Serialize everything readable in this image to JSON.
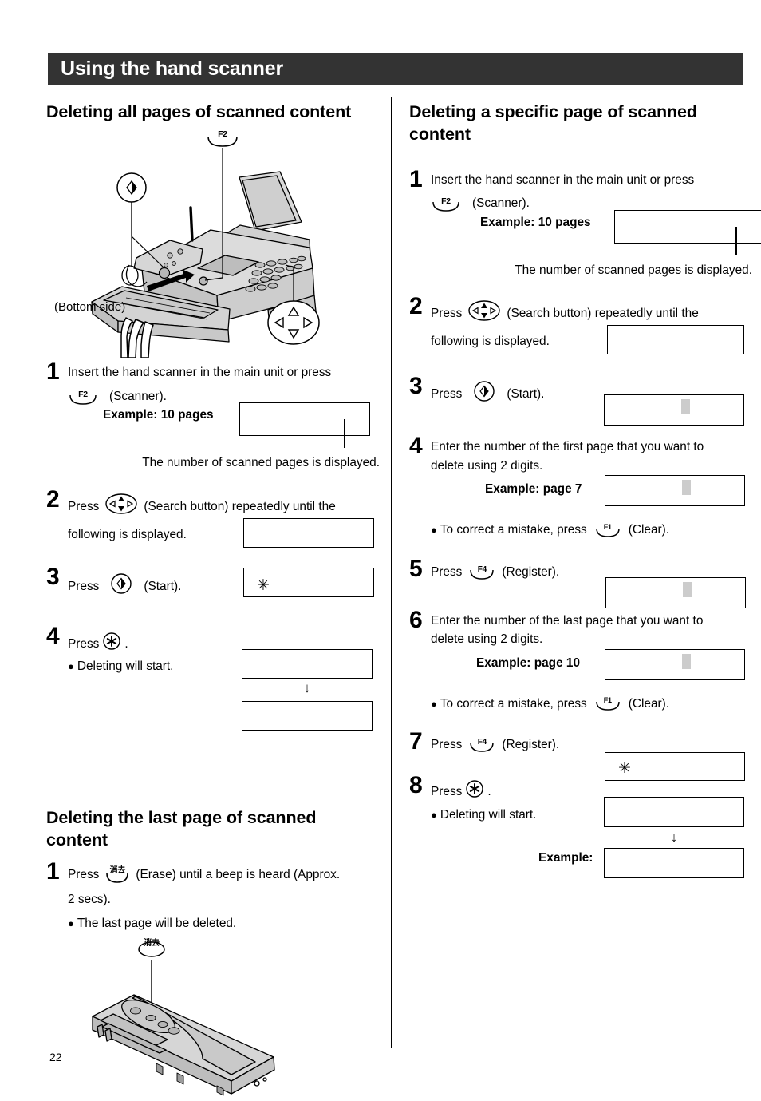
{
  "page": {
    "number": "22",
    "banner_title": "Using the hand scanner"
  },
  "left_column": {
    "section1": {
      "title": "Deleting all pages of scanned content",
      "illustration": {
        "key_label_f2": "F2",
        "caption_bottom_side": "(Bottom side)"
      },
      "steps": [
        {
          "num": "1",
          "text_line1": "Insert the hand scanner in the main unit or press",
          "key_label": "F2",
          "key_caption": "(Scanner).",
          "example_label": "Example: 10 pages",
          "note": "The number of scanned pages is displayed.",
          "lcd": {
            "content": "",
            "cursor": false,
            "tick": true
          }
        },
        {
          "num": "2",
          "text_line1": "Press",
          "key_name": "search-button",
          "text_line2": "(Search button) repeatedly until the",
          "text_line3": "following is displayed.",
          "lcd": {
            "content": "",
            "cursor": false,
            "tick": false
          }
        },
        {
          "num": "3",
          "text_line1": "Press",
          "key_name": "start-button",
          "text_line2": "(Start).",
          "lcd": {
            "content": "✳",
            "cursor": false,
            "tick": false
          }
        },
        {
          "num": "4",
          "text_line1": "Press",
          "key_name": "asterisk-button",
          "text_line2": ".",
          "bullet": "Deleting will start.",
          "lcd": {
            "content": "",
            "cursor": false,
            "tick": false
          },
          "lcd2": {
            "content": "",
            "cursor": false,
            "tick": false
          },
          "arrow": "↓"
        }
      ]
    },
    "section2": {
      "title": "Deleting the last page of scanned content",
      "steps": [
        {
          "num": "1",
          "text_line1": "Press",
          "key_label_jp": "消去",
          "text_line2": "(Erase) until a beep is heard (Approx.",
          "text_line3": "2 secs).",
          "bullet": "The last page will be deleted."
        }
      ],
      "illustration": {
        "key_label_jp": "消去"
      }
    }
  },
  "right_column": {
    "section1": {
      "title": "Deleting a specific page of scanned content",
      "steps": [
        {
          "num": "1",
          "text_line1": "Insert the hand scanner in the main unit or press",
          "key_label": "F2",
          "key_caption": "(Scanner).",
          "example_label": "Example: 10 pages",
          "note": "The number of scanned pages is displayed.",
          "lcd": {
            "content": "",
            "cursor": false,
            "tick": true
          }
        },
        {
          "num": "2",
          "text_line1": "Press",
          "key_name": "search-button",
          "text_line2": "(Search button) repeatedly until the",
          "text_line3": "following is displayed.",
          "lcd": {
            "content": "",
            "cursor": false,
            "tick": false
          }
        },
        {
          "num": "3",
          "text_line1": "Press",
          "key_name": "start-button",
          "text_line2": "(Start).",
          "lcd": {
            "content": "",
            "cursor": true,
            "tick": false
          }
        },
        {
          "num": "4",
          "text_line1": "Enter the number of the first page that you want to",
          "text_line2": "delete using 2 digits.",
          "example_label": "Example: page 7",
          "bullet_pre": "To correct a mistake, press",
          "bullet_key": "F1",
          "bullet_post": "(Clear).",
          "lcd": {
            "content": "",
            "cursor": true,
            "tick": false
          }
        },
        {
          "num": "5",
          "text_line1": "Press",
          "key_label": "F4",
          "text_line2": "(Register).",
          "lcd": {
            "content": "",
            "cursor": true,
            "tick": false
          }
        },
        {
          "num": "6",
          "text_line1": "Enter the number of the last page that you want to",
          "text_line2": "delete using 2 digits.",
          "example_label": "Example: page 10",
          "bullet_pre": "To correct a mistake, press",
          "bullet_key": "F1",
          "bullet_post": "(Clear).",
          "lcd": {
            "content": "",
            "cursor": true,
            "tick": false
          }
        },
        {
          "num": "7",
          "text_line1": "Press",
          "key_label": "F4",
          "text_line2": "(Register).",
          "lcd": {
            "content": "✳",
            "cursor": false,
            "tick": false
          }
        },
        {
          "num": "8",
          "text_line1": "Press",
          "key_name": "asterisk-button",
          "text_line2": ".",
          "bullet": "Deleting will start.",
          "lcd": {
            "content": "",
            "cursor": false,
            "tick": false
          },
          "arrow": "↓",
          "example_label": "Example:",
          "lcd2": {
            "content": "",
            "cursor": false,
            "tick": false
          }
        }
      ]
    }
  },
  "colors": {
    "banner_bg": "#333333",
    "cursor_gray": "#cccccc",
    "illustration_fill": "#d0d0d0"
  }
}
